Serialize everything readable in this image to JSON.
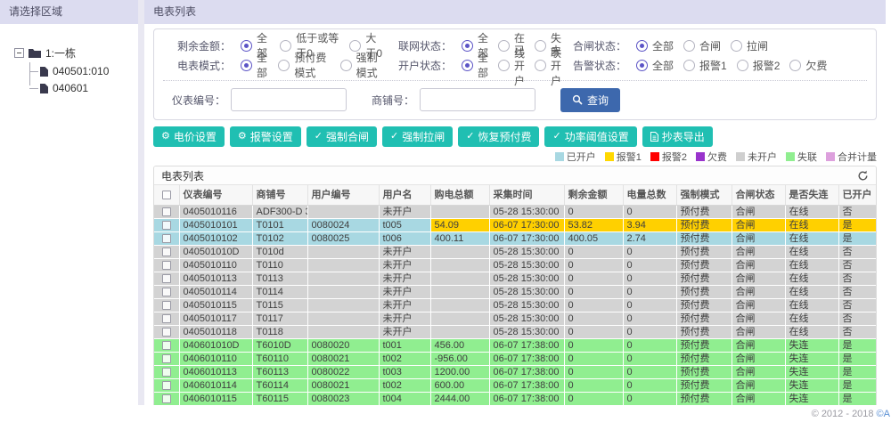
{
  "left_panel": {
    "title": "请选择区域",
    "root_label": "1:一栋",
    "children": [
      "040501:010",
      "040601"
    ]
  },
  "main": {
    "title": "电表列表",
    "filter_rows": [
      {
        "groups": [
          {
            "label": "剩余金额：",
            "options": [
              "全部",
              "低于或等于0",
              "大于0"
            ],
            "selected": 0
          },
          {
            "label": "联网状态：",
            "options": [
              "全部",
              "在线",
              "失联"
            ],
            "selected": 0
          },
          {
            "label": "合闸状态：",
            "options": [
              "全部",
              "合闸",
              "拉闸"
            ],
            "selected": 0
          }
        ]
      },
      {
        "groups": [
          {
            "label": "电表模式：",
            "options": [
              "全部",
              "预付费模式",
              "强制模式"
            ],
            "selected": 0
          },
          {
            "label": "开户状态：",
            "options": [
              "全部",
              "已开户",
              "未开户"
            ],
            "selected": 0
          },
          {
            "label": "告警状态：",
            "options": [
              "全部",
              "报警1",
              "报警2",
              "欠费"
            ],
            "selected": 0
          }
        ]
      }
    ],
    "search": {
      "meter_label": "仪表编号：",
      "meter_value": "",
      "shop_label": "商铺号：",
      "shop_value": "",
      "button_label": "查询"
    },
    "actions": [
      {
        "name": "price-settings",
        "icon": "gear",
        "label": "电价设置"
      },
      {
        "name": "alarm-settings",
        "icon": "gear",
        "label": "报警设置"
      },
      {
        "name": "force-close-switch",
        "icon": "check",
        "label": "强制合闸"
      },
      {
        "name": "force-open-switch",
        "icon": "check",
        "label": "强制拉闸"
      },
      {
        "name": "restore-prepaid",
        "icon": "check",
        "label": "恢复预付费"
      },
      {
        "name": "power-threshold-settings",
        "icon": "check",
        "label": "功率阈值设置"
      },
      {
        "name": "meter-export",
        "icon": "doc",
        "label": "抄表导出"
      }
    ],
    "legend": [
      {
        "label": "已开户",
        "color": "#a8d8e2"
      },
      {
        "label": "报警1",
        "color": "#ffd800"
      },
      {
        "label": "报警2",
        "color": "#ff0000"
      },
      {
        "label": "欠费",
        "color": "#9933cc"
      },
      {
        "label": "未开户",
        "color": "#cfcfcf"
      },
      {
        "label": "失联",
        "color": "#90ee90"
      },
      {
        "label": "合并计量",
        "color": "#dda0dd"
      }
    ],
    "table": {
      "title": "电表列表",
      "columns": [
        "仪表编号",
        "商铺号",
        "用户编号",
        "用户名",
        "购电总额",
        "采集时间",
        "剩余金额",
        "电量总数",
        "强制模式",
        "合闸状态",
        "是否失连",
        "已开户"
      ],
      "rows": [
        {
          "color": "row_not_opened",
          "cells": [
            "0405010116",
            "ADF300-D 3",
            "",
            "未开户",
            "",
            "05-28 15:30:00",
            "0",
            "0",
            "预付费",
            "合闸",
            "在线",
            "否"
          ]
        },
        {
          "color": "row_opened",
          "highlight_from": 4,
          "highlight_color": "row_alarm1",
          "cells": [
            "0405010101",
            "T0101",
            "0080024",
            "t005",
            "54.09",
            "06-07 17:30:00",
            "53.82",
            "3.94",
            "预付费",
            "合闸",
            "在线",
            "是"
          ]
        },
        {
          "color": "row_opened",
          "cells": [
            "0405010102",
            "T0102",
            "0080025",
            "t006",
            "400.11",
            "06-07 17:30:00",
            "400.05",
            "2.74",
            "预付费",
            "合闸",
            "在线",
            "是"
          ]
        },
        {
          "color": "row_not_opened",
          "cells": [
            "040501010D",
            "T010d",
            "",
            "未开户",
            "",
            "05-28 15:30:00",
            "0",
            "0",
            "预付费",
            "合闸",
            "在线",
            "否"
          ]
        },
        {
          "color": "row_not_opened",
          "cells": [
            "0405010110",
            "T0110",
            "",
            "未开户",
            "",
            "05-28 15:30:00",
            "0",
            "0",
            "预付费",
            "合闸",
            "在线",
            "否"
          ]
        },
        {
          "color": "row_not_opened",
          "cells": [
            "0405010113",
            "T0113",
            "",
            "未开户",
            "",
            "05-28 15:30:00",
            "0",
            "0",
            "预付费",
            "合闸",
            "在线",
            "否"
          ]
        },
        {
          "color": "row_not_opened",
          "cells": [
            "0405010114",
            "T0114",
            "",
            "未开户",
            "",
            "05-28 15:30:00",
            "0",
            "0",
            "预付费",
            "合闸",
            "在线",
            "否"
          ]
        },
        {
          "color": "row_not_opened",
          "cells": [
            "0405010115",
            "T0115",
            "",
            "未开户",
            "",
            "05-28 15:30:00",
            "0",
            "0",
            "预付费",
            "合闸",
            "在线",
            "否"
          ]
        },
        {
          "color": "row_not_opened",
          "cells": [
            "0405010117",
            "T0117",
            "",
            "未开户",
            "",
            "05-28 15:30:00",
            "0",
            "0",
            "预付费",
            "合闸",
            "在线",
            "否"
          ]
        },
        {
          "color": "row_not_opened",
          "cells": [
            "0405010118",
            "T0118",
            "",
            "未开户",
            "",
            "05-28 15:30:00",
            "0",
            "0",
            "预付费",
            "合闸",
            "在线",
            "否"
          ]
        },
        {
          "color": "row_lost",
          "cells": [
            "040601010D",
            "T6010D",
            "0080020",
            "t001",
            "456.00",
            "06-07 17:38:00",
            "0",
            "0",
            "预付费",
            "合闸",
            "失连",
            "是"
          ]
        },
        {
          "color": "row_lost",
          "cells": [
            "0406010110",
            "T60110",
            "0080021",
            "t002",
            "-956.00",
            "06-07 17:38:00",
            "0",
            "0",
            "预付费",
            "合闸",
            "失连",
            "是"
          ]
        },
        {
          "color": "row_lost",
          "cells": [
            "0406010113",
            "T60113",
            "0080022",
            "t003",
            "1200.00",
            "06-07 17:38:00",
            "0",
            "0",
            "预付费",
            "合闸",
            "失连",
            "是"
          ]
        },
        {
          "color": "row_lost",
          "cells": [
            "0406010114",
            "T60114",
            "0080021",
            "t002",
            "600.00",
            "06-07 17:38:00",
            "0",
            "0",
            "预付费",
            "合闸",
            "失连",
            "是"
          ]
        },
        {
          "color": "row_lost",
          "cells": [
            "0406010115",
            "T60115",
            "0080023",
            "t004",
            "2444.00",
            "06-07 17:38:00",
            "0",
            "0",
            "预付费",
            "合闸",
            "失连",
            "是"
          ]
        }
      ]
    }
  },
  "colors": {
    "accent_teal": "#20bfb2",
    "accent_blue": "#3d68ad",
    "radio_selected": "#5c54c6",
    "panel_header_bg": "#dcdcf0",
    "row_opened": "#a8d8e2",
    "row_alarm1": "#ffd000",
    "row_not_opened": "#d3d3d3",
    "row_lost": "#90ee90"
  },
  "footer": {
    "text": "© 2012 - 2018",
    "link_text": "©A"
  }
}
